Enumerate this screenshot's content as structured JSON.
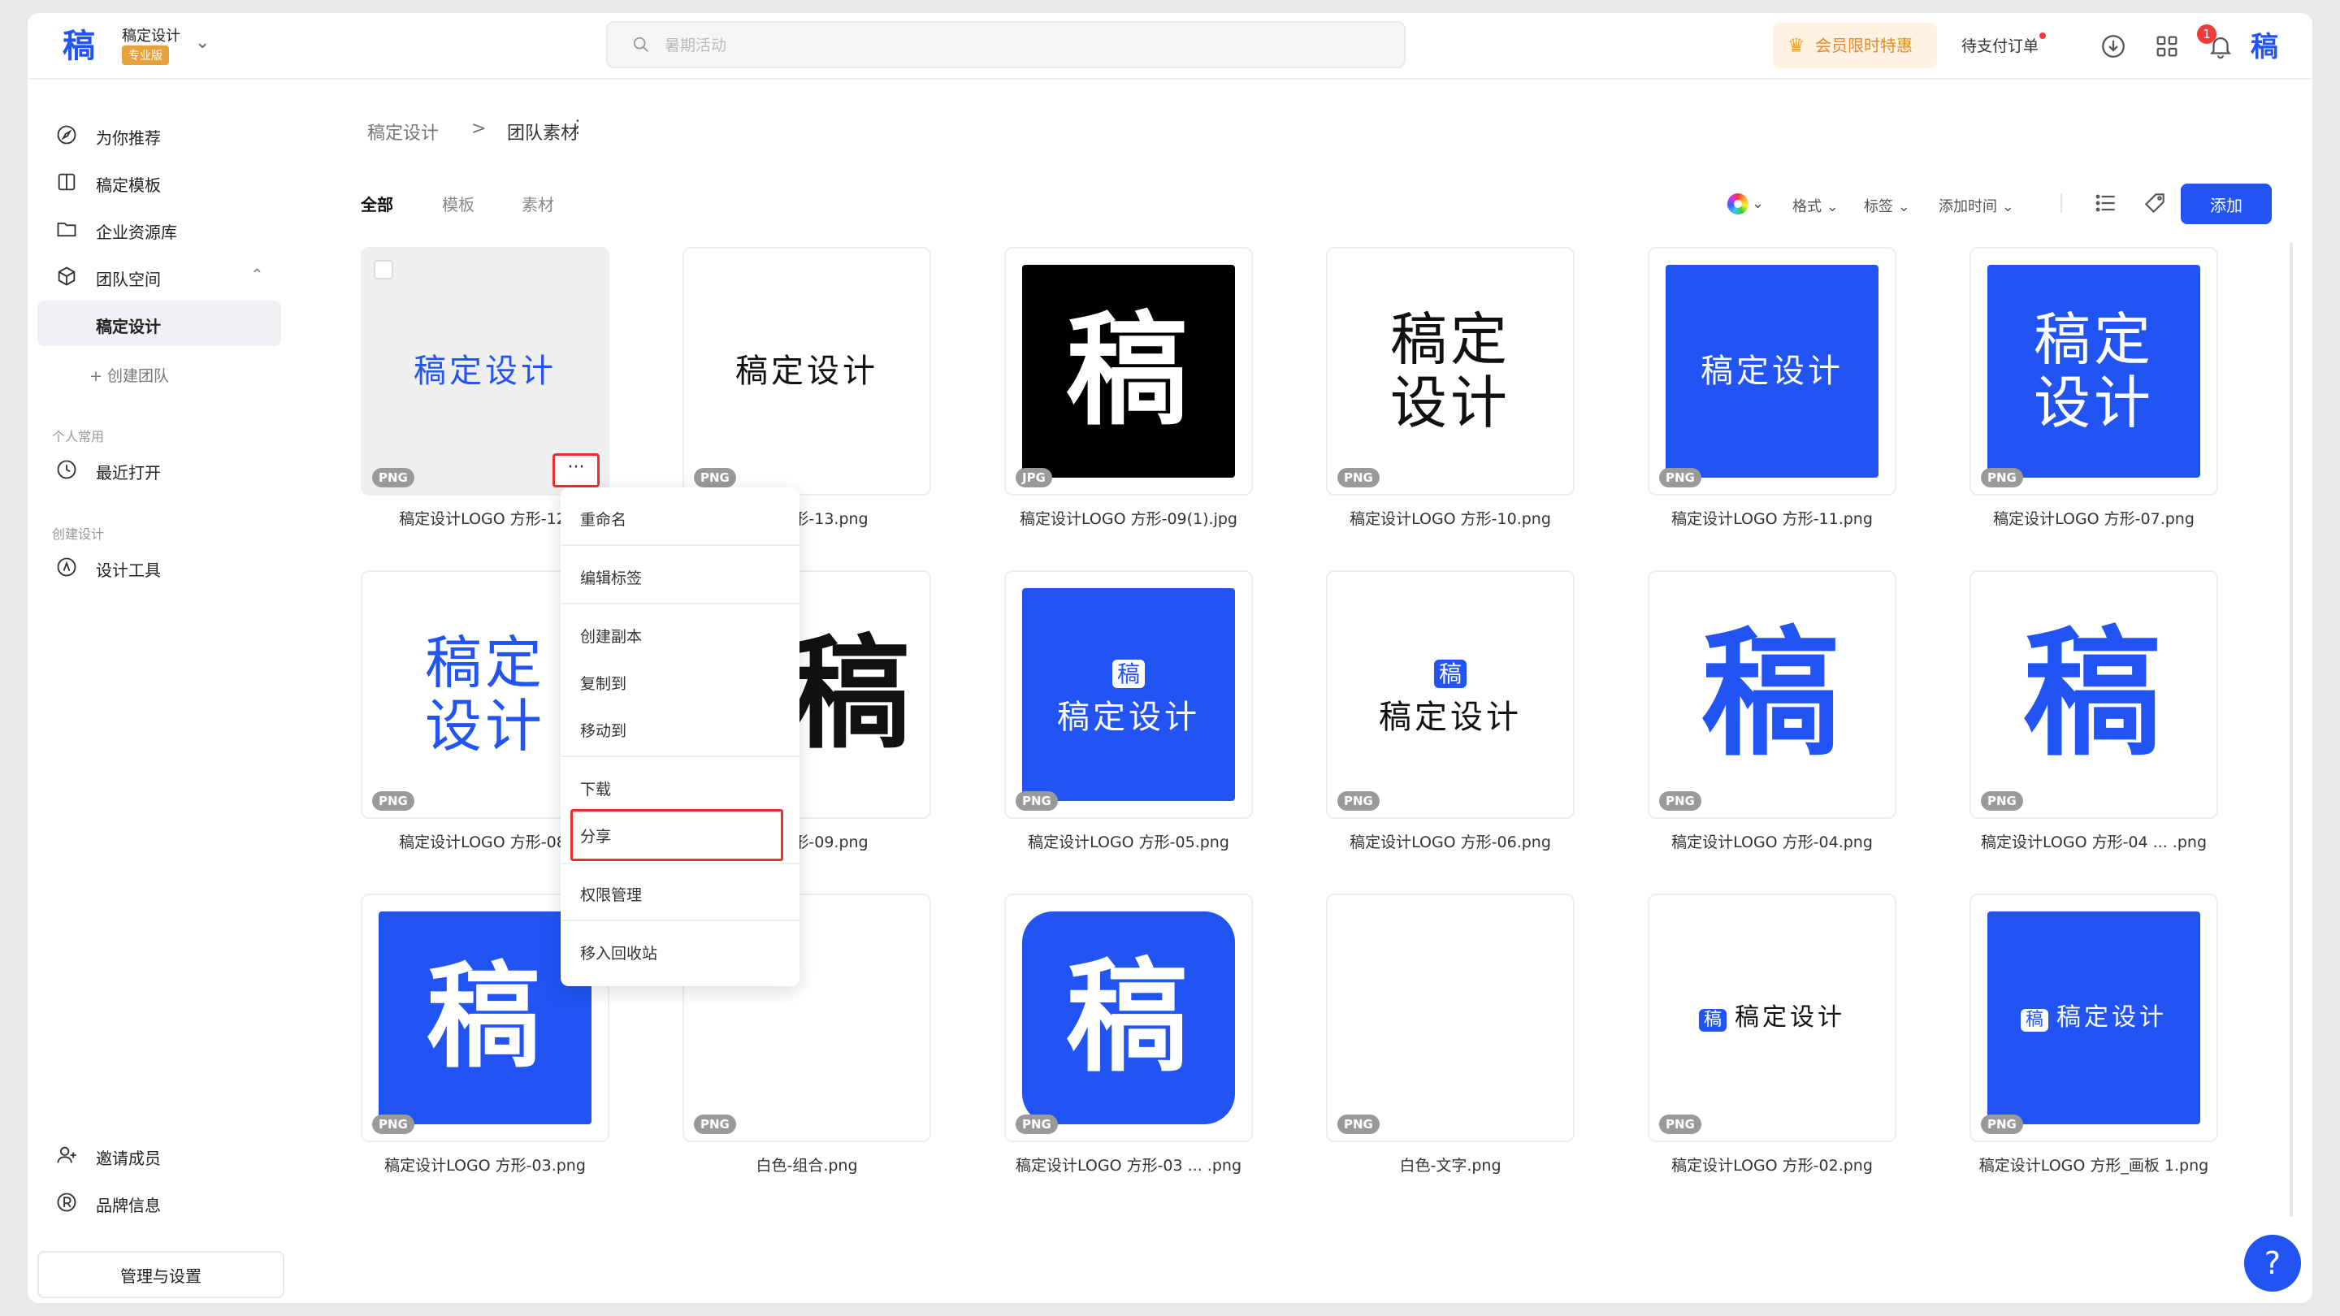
{
  "brand": {
    "logo_char": "稿",
    "name": "稿定设计",
    "badge": "专业版"
  },
  "search": {
    "placeholder": "暑期活动"
  },
  "topbar": {
    "vip_label": "会员限时特惠",
    "pending_label": "待支付订单",
    "notification_count": "1",
    "avatar_char": "稿"
  },
  "sidebar": {
    "items": [
      {
        "label": "为你推荐",
        "icon": "compass-icon"
      },
      {
        "label": "稿定模板",
        "icon": "template-icon"
      },
      {
        "label": "企业资源库",
        "icon": "folder-icon"
      },
      {
        "label": "团队空间",
        "icon": "cube-icon"
      },
      {
        "label": "稿定设计",
        "active": true
      },
      {
        "label": "+ 创建团队"
      }
    ],
    "group_personal": "个人常用",
    "recent": "最近打开",
    "group_create": "创建设计",
    "design_tools": "设计工具",
    "invite": "邀请成员",
    "brand_info": "品牌信息",
    "manage": "管理与设置"
  },
  "breadcrumb": {
    "root": "稿定设计",
    "separator": ">",
    "current": "团队素材",
    "more": "⋮"
  },
  "tabs": [
    {
      "label": "全部",
      "active": true
    },
    {
      "label": "模板"
    },
    {
      "label": "素材"
    }
  ],
  "filters": {
    "format": "格式",
    "tag": "标签",
    "time": "添加时间",
    "add": "添加"
  },
  "assets": [
    {
      "name": "稿定设计LOGO 方形-12.",
      "badge": "PNG",
      "text": "稿定设计"
    },
    {
      "name": "…O 方形-13.png",
      "badge": "PNG",
      "text": "稿定设计"
    },
    {
      "name": "稿定设计LOGO 方形-09(1).jpg",
      "badge": "JPG",
      "text": "稿"
    },
    {
      "name": "稿定设计LOGO 方形-10.png",
      "badge": "PNG",
      "text": "稿定\n设计"
    },
    {
      "name": "稿定设计LOGO 方形-11.png",
      "badge": "PNG",
      "text": "稿定设计"
    },
    {
      "name": "稿定设计LOGO 方形-07.png",
      "badge": "PNG",
      "text": "稿定\n设计"
    },
    {
      "name": "稿定设计LOGO 方形-08.",
      "badge": "PNG",
      "text": "稿定\n设计"
    },
    {
      "name": "…O 方形-09.png",
      "badge": "PNG",
      "text": "稿"
    },
    {
      "name": "稿定设计LOGO 方形-05.png",
      "badge": "PNG",
      "text": "稿定设计",
      "mini": "稿"
    },
    {
      "name": "稿定设计LOGO 方形-06.png",
      "badge": "PNG",
      "text": "稿定设计",
      "mini": "稿"
    },
    {
      "name": "稿定设计LOGO 方形-04.png",
      "badge": "PNG",
      "text": "稿"
    },
    {
      "name": "稿定设计LOGO 方形-04 ...  .png",
      "badge": "PNG",
      "text": "稿"
    },
    {
      "name": "稿定设计LOGO 方形-03.png",
      "badge": "PNG",
      "text": "稿"
    },
    {
      "name": "白色-组合.png",
      "badge": "PNG",
      "text": ""
    },
    {
      "name": "稿定设计LOGO 方形-03 ...  .png",
      "badge": "PNG",
      "text": "稿"
    },
    {
      "name": "白色-文字.png",
      "badge": "PNG",
      "text": ""
    },
    {
      "name": "稿定设计LOGO 方形-02.png",
      "badge": "PNG",
      "text": "稿定设计",
      "mini": "稿"
    },
    {
      "name": "稿定设计LOGO 方形_画板 1.png",
      "badge": "PNG",
      "text": "稿定设计",
      "mini": "稿"
    }
  ],
  "card_more": "···",
  "context_menu": [
    "重命名",
    "编辑标签",
    "创建副本",
    "复制到",
    "移动到",
    "下载",
    "分享",
    "权限管理",
    "移入回收站"
  ],
  "help": "?",
  "colors": {
    "brand_blue": "#2254f4",
    "highlight_red": "#e8312f"
  }
}
